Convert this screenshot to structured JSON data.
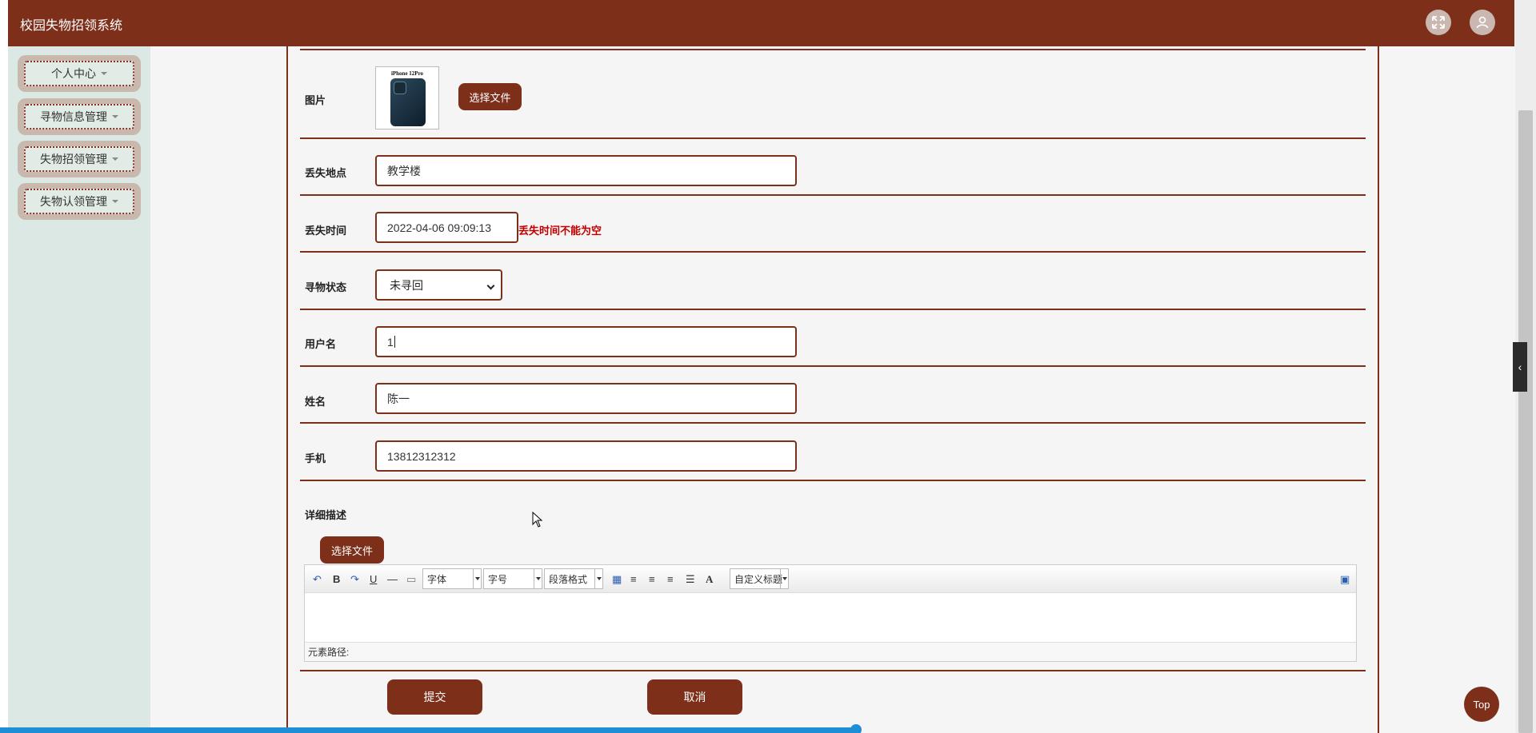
{
  "app": {
    "title": "校园失物招领系统"
  },
  "header": {
    "fullscreen_icon": "fullscreen-icon",
    "user_icon": "user-icon"
  },
  "sidebar": {
    "items": [
      {
        "label": "个人中心"
      },
      {
        "label": "寻物信息管理"
      },
      {
        "label": "失物招领管理"
      },
      {
        "label": "失物认领管理"
      }
    ]
  },
  "form": {
    "image": {
      "label": "图片",
      "thumb_caption": "iPhone 12Pro",
      "upload_label": "选择文件"
    },
    "location": {
      "label": "丢失地点",
      "value": "教学楼"
    },
    "time": {
      "label": "丢失时间",
      "value": "2022-04-06 09:09:13",
      "error": "丢失时间不能为空"
    },
    "status": {
      "label": "寻物状态",
      "value": "未寻回"
    },
    "username": {
      "label": "用户名",
      "value": "1"
    },
    "name": {
      "label": "姓名",
      "value": "陈一"
    },
    "phone": {
      "label": "手机",
      "value": "13812312312"
    },
    "description": {
      "label": "详细描述",
      "upload_label": "选择文件",
      "toolbar": {
        "bold": "B",
        "underline": "U",
        "hr": "—",
        "font_combo": "字体",
        "size_combo": "字号",
        "paragraph_combo": "段落格式",
        "fontcolor": "A",
        "custom_title_combo": "自定义标题"
      },
      "path_label": "元素路径:"
    },
    "submit_label": "提交",
    "cancel_label": "取消"
  },
  "ui": {
    "top_button": "Top",
    "side_tab_glyph": "‹"
  },
  "colors": {
    "brand": "#7d2f1a",
    "error": "#c00000",
    "progress": "#1e8fd6"
  }
}
